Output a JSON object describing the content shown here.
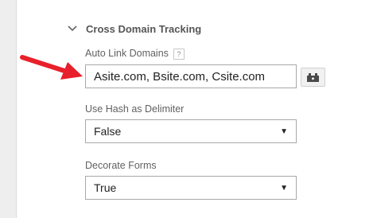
{
  "section": {
    "title": "Cross Domain Tracking",
    "chevron_icon": "chevron-down-icon"
  },
  "auto_link": {
    "label": "Auto Link Domains",
    "help_icon_text": "?",
    "value": "Asite.com, Bsite.com, Csite.com",
    "variable_icon": "variable-block-icon"
  },
  "use_hash": {
    "label": "Use Hash as Delimiter",
    "value": "False"
  },
  "decorate_forms": {
    "label": "Decorate Forms",
    "value": "True"
  },
  "annotation": {
    "arrow_color": "#e8202b",
    "arrow_icon": "red-pointer-arrow"
  }
}
